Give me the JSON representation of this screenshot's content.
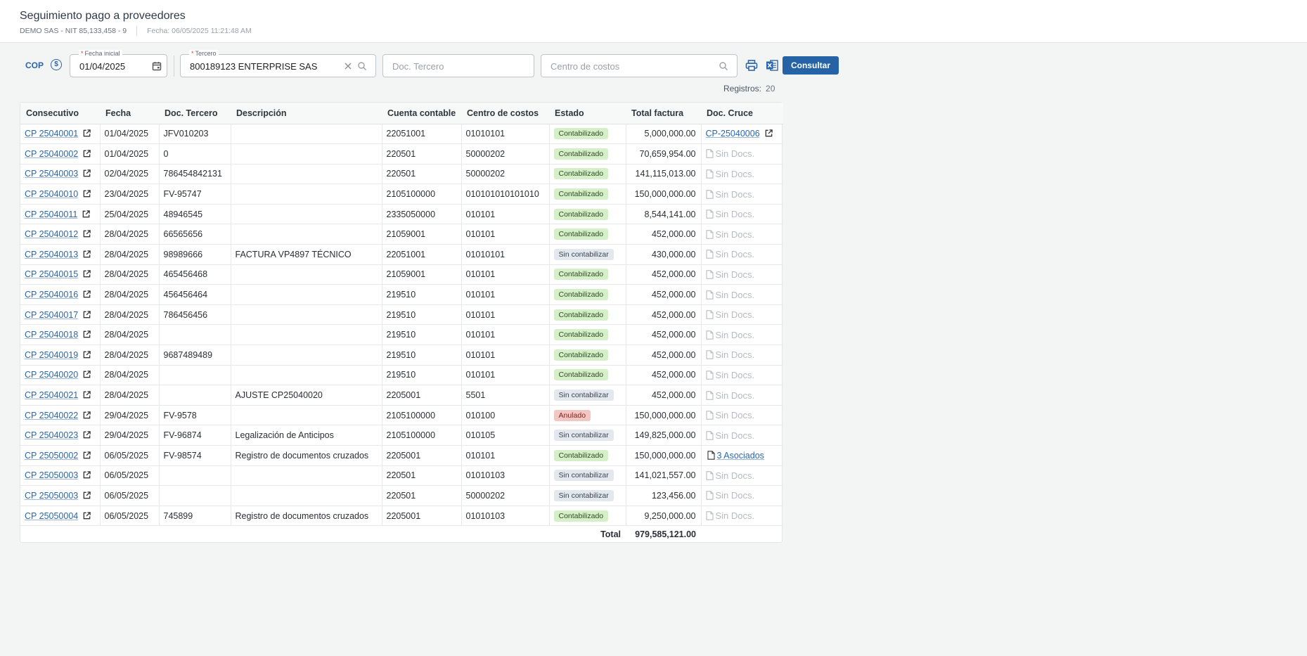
{
  "header": {
    "title": "Seguimiento pago a proveedores",
    "company": "DEMO SAS - NIT 85,133,458 - 9",
    "date": "Fecha: 06/05/2025 11:21:48 AM"
  },
  "filters": {
    "currency": "COP",
    "fecha_label": "Fecha inicial",
    "fecha_value": "01/04/2025",
    "tercero_label": "Tercero",
    "tercero_value": "800189123 ENTERPRISE SAS",
    "doc_placeholder": "Doc. Tercero",
    "cc_placeholder": "Centro de costos",
    "consultar_label": "Consultar"
  },
  "registros": {
    "label": "Registros:",
    "count": "20"
  },
  "table": {
    "columns": [
      "Consecutivo",
      "Fecha",
      "Doc. Tercero",
      "Descripción",
      "Cuenta contable",
      "Centro de costos",
      "Estado",
      "Total factura",
      "Doc. Cruce"
    ],
    "rows": [
      {
        "consecutivo": "CP 25040001",
        "fecha": "01/04/2025",
        "doc": "JFV010203",
        "desc": "",
        "cuenta": "22051001",
        "cc": "01010101",
        "estado": "Contabilizado",
        "total": "5,000,000.00",
        "cruce": "CP-25040006"
      },
      {
        "consecutivo": "CP 25040002",
        "fecha": "01/04/2025",
        "doc": "0",
        "desc": "",
        "cuenta": "220501",
        "cc": "50000202",
        "estado": "Contabilizado",
        "total": "70,659,954.00",
        "cruce": "Sin Docs."
      },
      {
        "consecutivo": "CP 25040003",
        "fecha": "02/04/2025",
        "doc": "786454842131",
        "desc": "",
        "cuenta": "220501",
        "cc": "50000202",
        "estado": "Contabilizado",
        "total": "141,115,013.00",
        "cruce": "Sin Docs."
      },
      {
        "consecutivo": "CP 25040010",
        "fecha": "23/04/2025",
        "doc": "FV-95747",
        "desc": "",
        "cuenta": "2105100000",
        "cc": "010101010101010",
        "estado": "Contabilizado",
        "total": "150,000,000.00",
        "cruce": "Sin Docs."
      },
      {
        "consecutivo": "CP 25040011",
        "fecha": "25/04/2025",
        "doc": "48946545",
        "desc": "",
        "cuenta": "2335050000",
        "cc": "010101",
        "estado": "Contabilizado",
        "total": "8,544,141.00",
        "cruce": "Sin Docs."
      },
      {
        "consecutivo": "CP 25040012",
        "fecha": "28/04/2025",
        "doc": "66565656",
        "desc": "",
        "cuenta": "21059001",
        "cc": "010101",
        "estado": "Contabilizado",
        "total": "452,000.00",
        "cruce": "Sin Docs."
      },
      {
        "consecutivo": "CP 25040013",
        "fecha": "28/04/2025",
        "doc": "98989666",
        "desc": "FACTURA VP4897 TÉCNICO",
        "cuenta": "22051001",
        "cc": "01010101",
        "estado": "Sin contabilizar",
        "total": "430,000.00",
        "cruce": "Sin Docs."
      },
      {
        "consecutivo": "CP 25040015",
        "fecha": "28/04/2025",
        "doc": "465456468",
        "desc": "",
        "cuenta": "21059001",
        "cc": "010101",
        "estado": "Contabilizado",
        "total": "452,000.00",
        "cruce": "Sin Docs."
      },
      {
        "consecutivo": "CP 25040016",
        "fecha": "28/04/2025",
        "doc": "456456464",
        "desc": "",
        "cuenta": "219510",
        "cc": "010101",
        "estado": "Contabilizado",
        "total": "452,000.00",
        "cruce": "Sin Docs."
      },
      {
        "consecutivo": "CP 25040017",
        "fecha": "28/04/2025",
        "doc": "786456456",
        "desc": "",
        "cuenta": "219510",
        "cc": "010101",
        "estado": "Contabilizado",
        "total": "452,000.00",
        "cruce": "Sin Docs."
      },
      {
        "consecutivo": "CP 25040018",
        "fecha": "28/04/2025",
        "doc": "",
        "desc": "",
        "cuenta": "219510",
        "cc": "010101",
        "estado": "Contabilizado",
        "total": "452,000.00",
        "cruce": "Sin Docs."
      },
      {
        "consecutivo": "CP 25040019",
        "fecha": "28/04/2025",
        "doc": "9687489489",
        "desc": "",
        "cuenta": "219510",
        "cc": "010101",
        "estado": "Contabilizado",
        "total": "452,000.00",
        "cruce": "Sin Docs."
      },
      {
        "consecutivo": "CP 25040020",
        "fecha": "28/04/2025",
        "doc": "",
        "desc": "",
        "cuenta": "219510",
        "cc": "010101",
        "estado": "Contabilizado",
        "total": "452,000.00",
        "cruce": "Sin Docs."
      },
      {
        "consecutivo": "CP 25040021",
        "fecha": "28/04/2025",
        "doc": "",
        "desc": "AJUSTE CP25040020",
        "cuenta": "2205001",
        "cc": "5501",
        "estado": "Sin contabilizar",
        "total": "452,000.00",
        "cruce": "Sin Docs."
      },
      {
        "consecutivo": "CP 25040022",
        "fecha": "29/04/2025",
        "doc": "FV-9578",
        "desc": "",
        "cuenta": "2105100000",
        "cc": "010100",
        "estado": "Anulado",
        "total": "150,000,000.00",
        "cruce": "Sin Docs."
      },
      {
        "consecutivo": "CP 25040023",
        "fecha": "29/04/2025",
        "doc": "FV-96874",
        "desc": "Legalización de Anticipos",
        "cuenta": "2105100000",
        "cc": "010105",
        "estado": "Sin contabilizar",
        "total": "149,825,000.00",
        "cruce": "Sin Docs."
      },
      {
        "consecutivo": "CP 25050002",
        "fecha": "06/05/2025",
        "doc": "FV-98574",
        "desc": "Registro de documentos cruzados",
        "cuenta": "2205001",
        "cc": "010101",
        "estado": "Contabilizado",
        "total": "150,000,000.00",
        "cruce": "3 Asociados"
      },
      {
        "consecutivo": "CP 25050003",
        "fecha": "06/05/2025",
        "doc": "",
        "desc": "",
        "cuenta": "220501",
        "cc": "01010103",
        "estado": "Sin contabilizar",
        "total": "141,021,557.00",
        "cruce": "Sin Docs."
      },
      {
        "consecutivo": "CP 25050003",
        "fecha": "06/05/2025",
        "doc": "",
        "desc": "",
        "cuenta": "220501",
        "cc": "50000202",
        "estado": "Sin contabilizar",
        "total": "123,456.00",
        "cruce": "Sin Docs."
      },
      {
        "consecutivo": "CP 25050004",
        "fecha": "06/05/2025",
        "doc": "745899",
        "desc": "Registro de documentos cruzados",
        "cuenta": "2205001",
        "cc": "01010103",
        "estado": "Contabilizado",
        "total": "9,250,000.00",
        "cruce": "Sin Docs."
      }
    ],
    "total_label": "Total",
    "total_value": "979,585,121.00"
  },
  "colors": {
    "accent": "#2563a6",
    "contabilizado": "#d5efc8",
    "sin_contabilizar": "#e3e8ee",
    "anulado": "#f2c6c3"
  }
}
